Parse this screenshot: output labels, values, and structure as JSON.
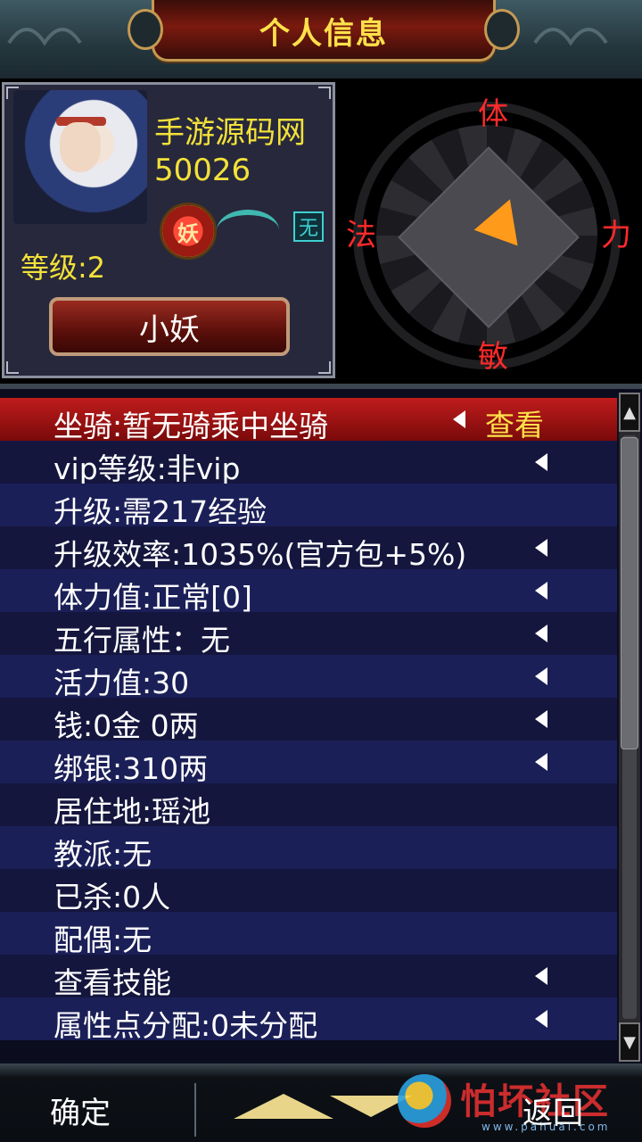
{
  "header": {
    "title": "个人信息"
  },
  "profile": {
    "name": "手游源码网",
    "id": "50026",
    "clan_badge": "妖",
    "element_tag": "无",
    "level": "等级:2",
    "rank_button": "小妖"
  },
  "radar": {
    "top": "体",
    "left": "法",
    "right": "力",
    "bottom": "敏",
    "arrow_color": "#ff9a1a"
  },
  "list": {
    "rows": [
      {
        "label": "坐骑:暂无骑乘中坐骑",
        "action": "查看",
        "arrow": true
      },
      {
        "label": "vip等级:非vip",
        "arrow": true
      },
      {
        "label": "升级:需217经验",
        "arrow": false
      },
      {
        "label": "升级效率:1035%(官方包+5%)",
        "arrow": true
      },
      {
        "label": "体力值:正常[0]",
        "arrow": true
      },
      {
        "label": "五行属性：无",
        "arrow": true
      },
      {
        "label": "活力值:30",
        "arrow": true
      },
      {
        "label": "钱:0金 0两",
        "arrow": true
      },
      {
        "label": "绑银:310两",
        "arrow": true
      },
      {
        "label": "居住地:瑶池",
        "arrow": false
      },
      {
        "label": "教派:无",
        "arrow": false
      },
      {
        "label": "已杀:0人",
        "arrow": false
      },
      {
        "label": "配偶:无",
        "arrow": false
      },
      {
        "label": "查看技能",
        "arrow": true
      },
      {
        "label": "属性点分配:0未分配",
        "arrow": true
      }
    ]
  },
  "footer": {
    "confirm": "确定",
    "back": "返回",
    "watermark": "怕坏社区",
    "watermark_url": "www.pahuai.com"
  },
  "colors": {
    "accent_yellow": "#f3e13a",
    "stat_red": "#ff2a2a",
    "selected_row": "#c01c1c"
  }
}
